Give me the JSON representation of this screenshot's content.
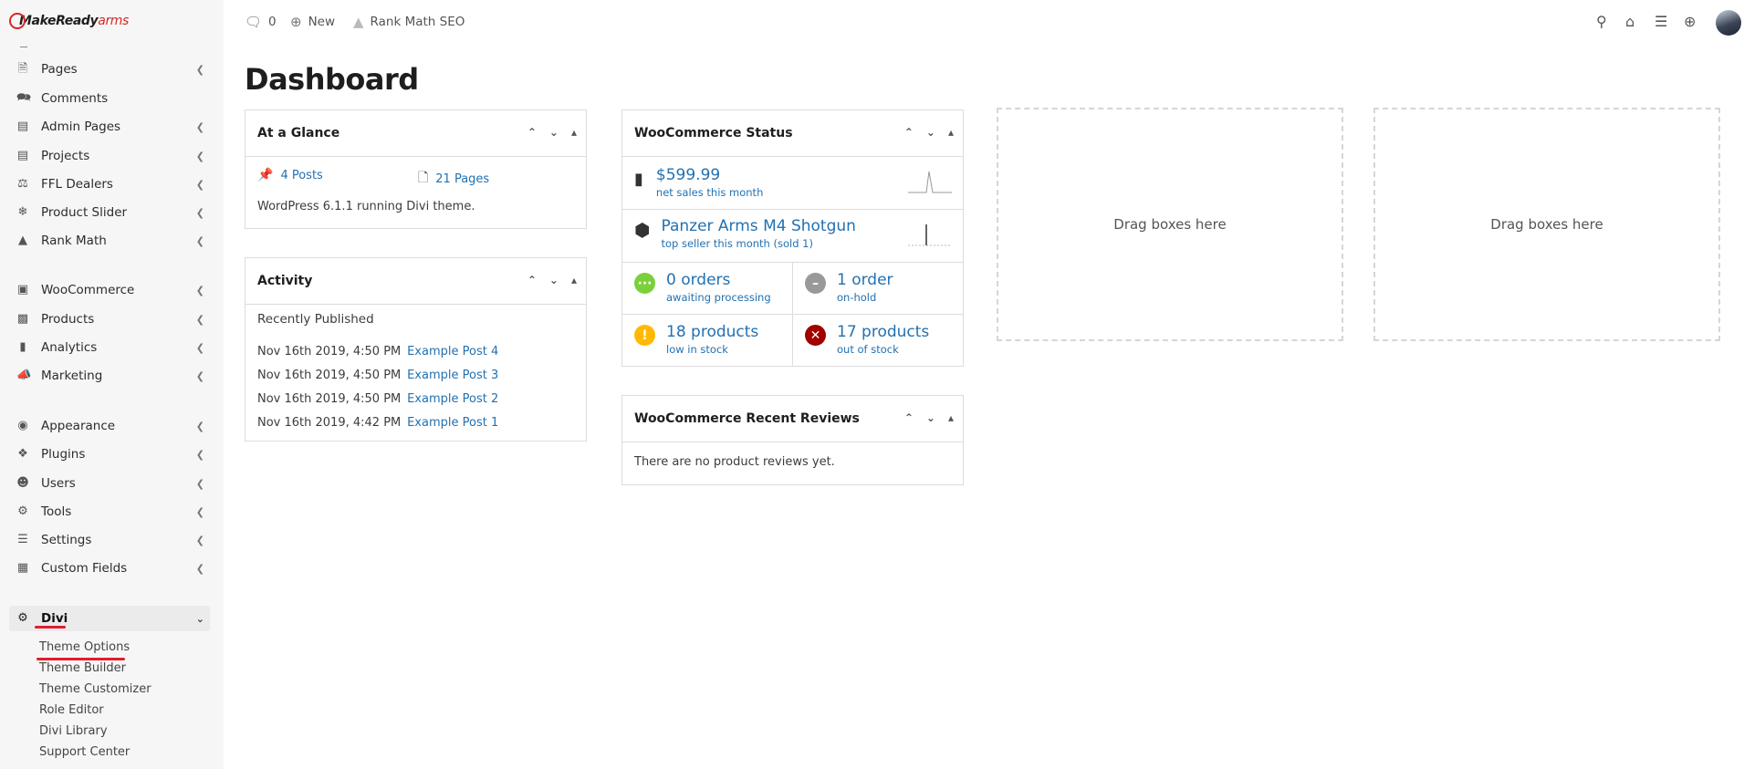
{
  "brand": {
    "logo_make": "MakeReady",
    "logo_arms": "arms"
  },
  "sidebar": {
    "items": [
      {
        "label": "Pages",
        "icon": "page-icon"
      },
      {
        "label": "Comments",
        "icon": "comments-icon"
      },
      {
        "label": "Admin Pages",
        "icon": "admin-pages-icon"
      },
      {
        "label": "Projects",
        "icon": "projects-icon"
      },
      {
        "label": "FFL Dealers",
        "icon": "dealers-icon"
      },
      {
        "label": "Product Slider",
        "icon": "slider-icon"
      },
      {
        "label": "Rank Math",
        "icon": "rank-math-icon"
      },
      {
        "label": "WooCommerce",
        "icon": "woocommerce-icon"
      },
      {
        "label": "Products",
        "icon": "products-icon"
      },
      {
        "label": "Analytics",
        "icon": "analytics-icon"
      },
      {
        "label": "Marketing",
        "icon": "megaphone-icon"
      },
      {
        "label": "Appearance",
        "icon": "palette-icon"
      },
      {
        "label": "Plugins",
        "icon": "plugin-icon"
      },
      {
        "label": "Users",
        "icon": "users-icon"
      },
      {
        "label": "Tools",
        "icon": "tools-icon"
      },
      {
        "label": "Settings",
        "icon": "settings-icon"
      },
      {
        "label": "Custom Fields",
        "icon": "custom-fields-icon"
      },
      {
        "label": "Divi",
        "icon": "gear-icon"
      }
    ],
    "divi_sub": [
      "Theme Options",
      "Theme Builder",
      "Theme Customizer",
      "Role Editor",
      "Divi Library",
      "Support Center"
    ]
  },
  "topbar": {
    "comments_count": "0",
    "new_label": "New",
    "rank_math_label": "Rank Math SEO"
  },
  "page_title": "Dashboard",
  "at_a_glance": {
    "title": "At a Glance",
    "posts": "4 Posts",
    "pages": "21 Pages",
    "running_text": "WordPress 6.1.1 running Divi theme."
  },
  "activity": {
    "title": "Activity",
    "recently_published": "Recently Published",
    "rows": [
      {
        "date": "Nov 16th 2019, 4:50 PM",
        "post": "Example Post 4"
      },
      {
        "date": "Nov 16th 2019, 4:50 PM",
        "post": "Example Post 3"
      },
      {
        "date": "Nov 16th 2019, 4:50 PM",
        "post": "Example Post 2"
      },
      {
        "date": "Nov 16th 2019, 4:42 PM",
        "post": "Example Post 1"
      }
    ]
  },
  "woo_status": {
    "title": "WooCommerce Status",
    "net_sales_value": "$599.99",
    "net_sales_label": "net sales this month",
    "top_seller_name": "Panzer Arms M4 Shotgun",
    "top_seller_label": "top seller this month (sold 1)",
    "awaiting_value": "0 orders",
    "awaiting_label": "awaiting processing",
    "onhold_value": "1 order",
    "onhold_label": "on-hold",
    "low_stock_value": "18 products",
    "low_stock_label": "low in stock",
    "out_stock_value": "17 products",
    "out_stock_label": "out of stock",
    "colors": {
      "green": "#7ad03a",
      "grey": "#999999",
      "orange": "#ffba00",
      "red": "#a00000"
    }
  },
  "woo_reviews": {
    "title": "WooCommerce Recent Reviews",
    "empty_text": "There are no product reviews yet."
  },
  "drop_zone_text": "Drag boxes here"
}
